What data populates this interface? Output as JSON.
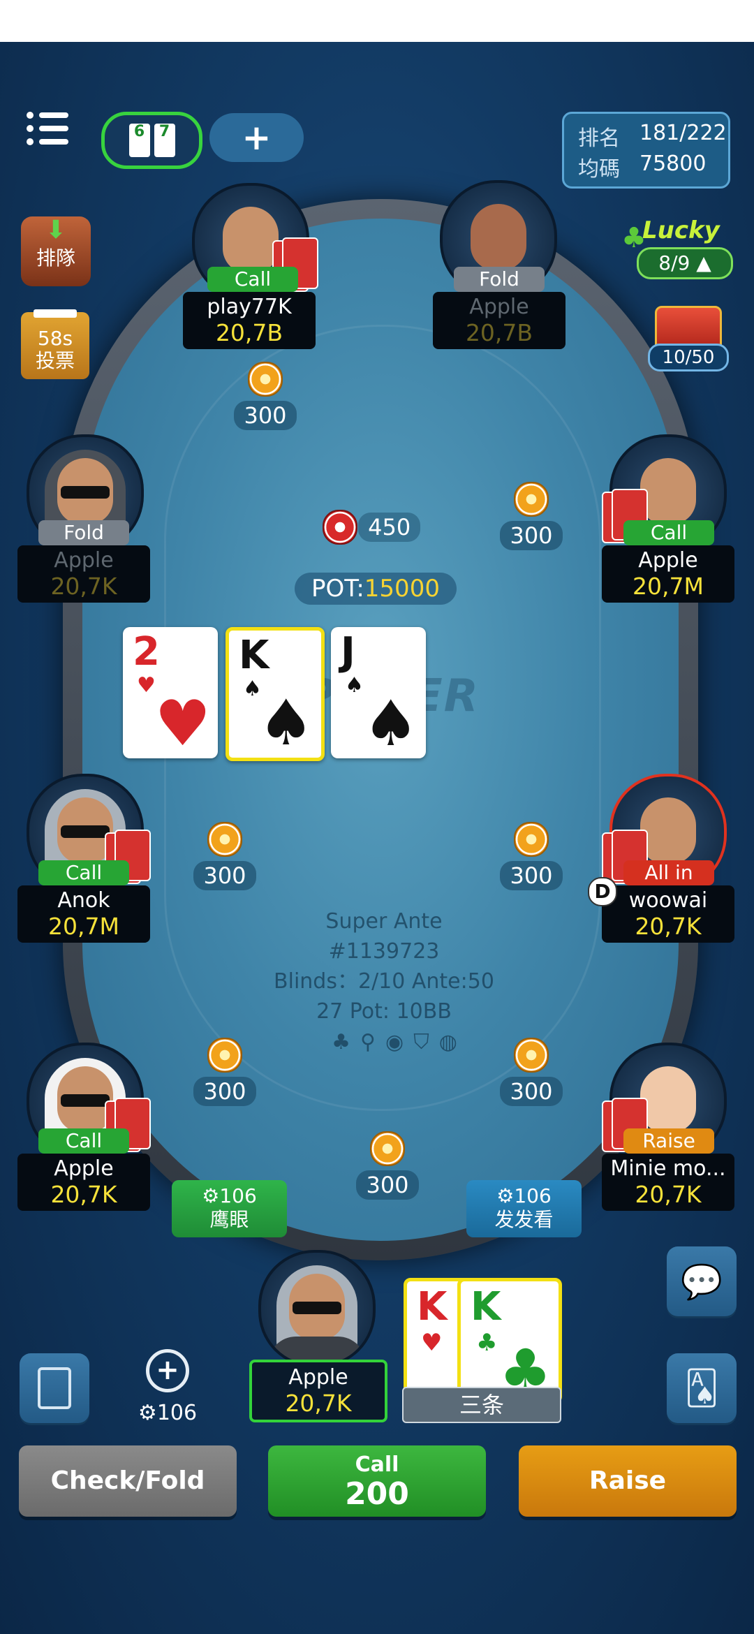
{
  "top": {
    "hole_cards": [
      "6",
      "7"
    ],
    "rank_label": "排名",
    "rank_value": "181/222",
    "avg_label": "均碼",
    "avg_value": "75800"
  },
  "side": {
    "queue_label": "排隊",
    "vote_time": "58s",
    "vote_label": "投票",
    "lucky_label": "Lucky",
    "lucky_value": "8/9",
    "chest_value": "10/50"
  },
  "players": [
    {
      "id": "top-left",
      "name": "play77K",
      "chips": "20,7B",
      "action": "Call",
      "bet": "300"
    },
    {
      "id": "top-right",
      "name": "Apple",
      "chips": "20,7B",
      "action": "Fold"
    },
    {
      "id": "left-upper",
      "name": "Apple",
      "chips": "20,7K",
      "action": "Fold"
    },
    {
      "id": "right-upper",
      "name": "Apple",
      "chips": "20,7M",
      "action": "Call",
      "bet": "300"
    },
    {
      "id": "left-middle",
      "name": "Anok",
      "chips": "20,7M",
      "action": "Call",
      "bet": "300"
    },
    {
      "id": "right-middle",
      "name": "woowai",
      "chips": "20,7K",
      "action": "All in",
      "bet": "300"
    },
    {
      "id": "left-lower",
      "name": "Apple",
      "chips": "20,7K",
      "action": "Call",
      "bet": "300"
    },
    {
      "id": "right-lower",
      "name": "Minie mo...",
      "chips": "20,7K",
      "action": "Raise",
      "bet": "300"
    },
    {
      "id": "hero",
      "name": "Apple",
      "chips": "20,7K",
      "bet": "300"
    }
  ],
  "table": {
    "center_bet": "450",
    "pot_label": "POT:",
    "pot_value": "15000",
    "watermark": "POKER",
    "community_cards": [
      {
        "rank": "2",
        "suit": "♥",
        "color": "#d8262b"
      },
      {
        "rank": "K",
        "suit": "♠",
        "color": "#111111"
      },
      {
        "rank": "J",
        "suit": "♠",
        "color": "#111111"
      }
    ],
    "info_lines": [
      "Super Ante",
      "#1139723",
      "Blinds：2/10  Ante:50",
      "27 Pot: 10BB"
    ],
    "dealer_button": "D",
    "prop_left_count": "106",
    "prop_left_label": "鹰眼",
    "prop_right_count": "106",
    "prop_right_label": "发发看"
  },
  "hero": {
    "cards": [
      {
        "rank": "K",
        "suit": "♥",
        "color": "#d8262b"
      },
      {
        "rank": "K",
        "suit": "♣",
        "color": "#1f9c2e"
      }
    ],
    "hand_label": "三条",
    "timer_count": "106"
  },
  "actions": {
    "fold": "Check/Fold",
    "call_label": "Call",
    "call_value": "200",
    "raise": "Raise"
  },
  "colors": {
    "call": "#27a534",
    "fold": "#77808a",
    "allin": "#d5301f",
    "raise": "#e08a12",
    "chips": "#f7e23a"
  }
}
